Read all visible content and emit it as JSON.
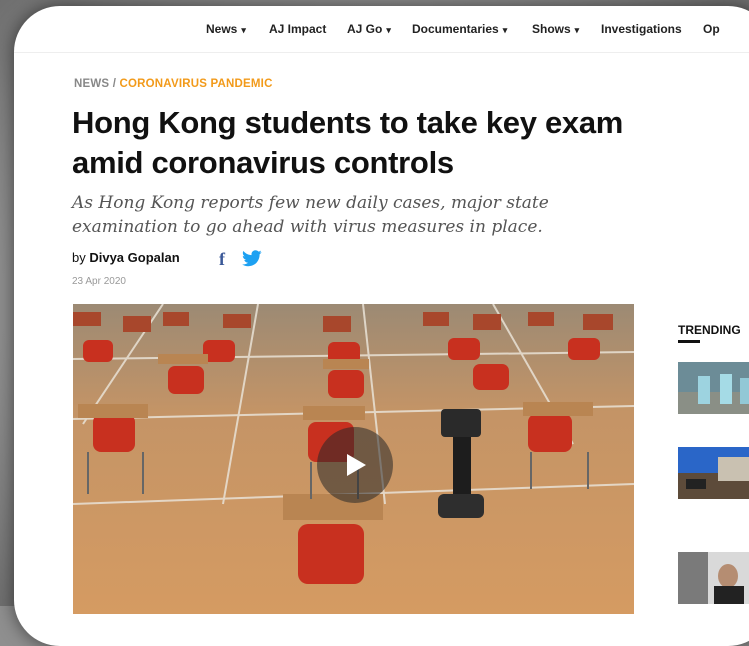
{
  "nav": {
    "items": [
      {
        "label": "News",
        "dropdown": true
      },
      {
        "label": "AJ Impact",
        "dropdown": false
      },
      {
        "label": "AJ Go",
        "dropdown": true
      },
      {
        "label": "Documentaries",
        "dropdown": true
      },
      {
        "label": "Shows",
        "dropdown": true
      },
      {
        "label": "Investigations",
        "dropdown": false
      },
      {
        "label": "Op",
        "dropdown": false
      }
    ],
    "caret": "▾"
  },
  "breadcrumb": {
    "section": "NEWS",
    "separator": " / ",
    "topic": "CORONAVIRUS PANDEMIC"
  },
  "article": {
    "headline": "Hong Kong students to take key exam amid coronavirus controls",
    "subhead": "As Hong Kong reports few new daily cases, major state examination to go ahead with virus measures in place.",
    "byline_prefix": "by ",
    "author": "Divya Gopalan",
    "date": "23 Apr 2020"
  },
  "share": {
    "facebook_glyph": "f"
  },
  "sidebar": {
    "trending_label": "TRENDING"
  },
  "colors": {
    "accent": "#f29a1a",
    "facebook": "#3b5998",
    "twitter": "#1da1f2"
  }
}
